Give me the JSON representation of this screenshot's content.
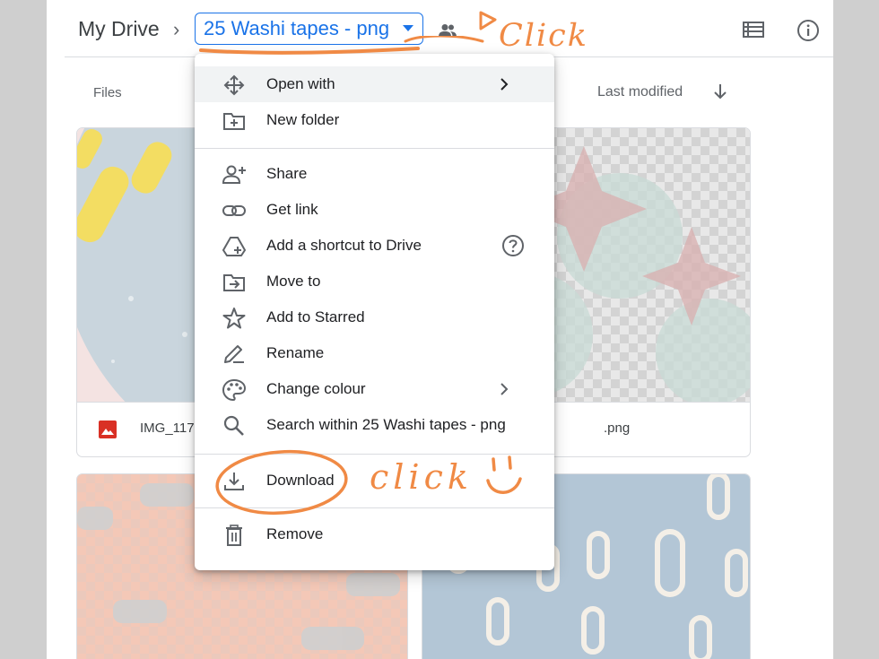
{
  "breadcrumb": {
    "root": "My Drive",
    "separator": "›",
    "current": "25 Washi tapes - png"
  },
  "toolbar": {
    "shared_icon": "people-icon",
    "list_icon": "list-view-icon",
    "info_icon": "info-icon"
  },
  "section": {
    "files_label": "Files",
    "sort_label": "Last modified",
    "sort_icon": "arrow-down-icon"
  },
  "files": [
    {
      "name": "IMG_117",
      "icon": "image-file-icon"
    },
    {
      "name": ".png",
      "icon": "image-file-icon"
    }
  ],
  "menu": {
    "items": [
      {
        "label": "Open with",
        "icon": "move-icon"
      },
      {
        "label": "New folder",
        "icon": "new-folder-icon"
      },
      {
        "label": "Share",
        "icon": "add-person-icon"
      },
      {
        "label": "Get link",
        "icon": "link-icon"
      },
      {
        "label": "Add a shortcut to Drive",
        "icon": "drive-shortcut-icon"
      },
      {
        "label": "Move to",
        "icon": "move-to-folder-icon"
      },
      {
        "label": "Add to Starred",
        "icon": "star-icon"
      },
      {
        "label": "Rename",
        "icon": "pencil-icon"
      },
      {
        "label": "Change colour",
        "icon": "palette-icon"
      },
      {
        "label": "Search within 25 Washi tapes - png",
        "icon": "search-icon"
      },
      {
        "label": "Download",
        "icon": "download-icon"
      },
      {
        "label": "Remove",
        "icon": "trash-icon"
      }
    ]
  },
  "annotations": {
    "top_click": "Click",
    "download_click": "click"
  },
  "colors": {
    "accent": "#1a73e8",
    "annotation": "#f08a45",
    "image_icon": "#d93025"
  }
}
